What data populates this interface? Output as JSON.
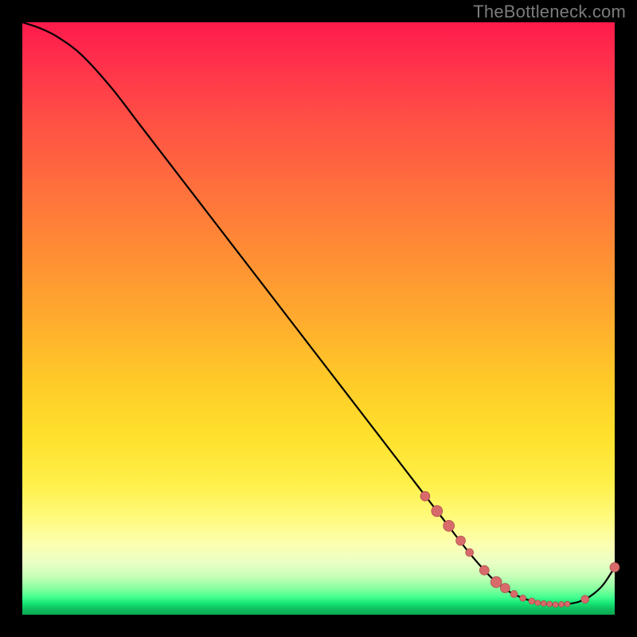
{
  "watermark": "TheBottleneck.com",
  "colors": {
    "background": "#000000",
    "curve": "#000000",
    "marker_fill": "#d86a6a",
    "marker_stroke": "#a04444"
  },
  "chart_data": {
    "type": "line",
    "title": "",
    "xlabel": "",
    "ylabel": "",
    "xlim": [
      0,
      100
    ],
    "ylim": [
      0,
      100
    ],
    "grid": false,
    "x": [
      0,
      3,
      6,
      10,
      15,
      20,
      25,
      30,
      35,
      40,
      45,
      50,
      55,
      60,
      65,
      70,
      75,
      78,
      80,
      82,
      84,
      86,
      88,
      90,
      92,
      94,
      96,
      98,
      100
    ],
    "y": [
      100,
      99,
      97.5,
      94.5,
      89,
      82.5,
      76,
      69.5,
      63,
      56.5,
      50,
      43.5,
      37,
      30.5,
      24,
      17.5,
      11,
      7.5,
      5.5,
      4,
      3,
      2.3,
      1.9,
      1.7,
      1.8,
      2.2,
      3.2,
      5,
      8
    ],
    "series": [
      {
        "name": "curve",
        "x": [
          0,
          3,
          6,
          10,
          15,
          20,
          25,
          30,
          35,
          40,
          45,
          50,
          55,
          60,
          65,
          70,
          75,
          78,
          80,
          82,
          84,
          86,
          88,
          90,
          92,
          94,
          96,
          98,
          100
        ],
        "y": [
          100,
          99,
          97.5,
          94.5,
          89,
          82.5,
          76,
          69.5,
          63,
          56.5,
          50,
          43.5,
          37,
          30.5,
          24,
          17.5,
          11,
          7.5,
          5.5,
          4,
          3,
          2.3,
          1.9,
          1.7,
          1.8,
          2.2,
          3.2,
          5,
          8
        ]
      }
    ],
    "markers": [
      {
        "x": 68,
        "y": 20,
        "r": 6
      },
      {
        "x": 70,
        "y": 17.5,
        "r": 7
      },
      {
        "x": 72,
        "y": 15,
        "r": 7
      },
      {
        "x": 74,
        "y": 12.5,
        "r": 6
      },
      {
        "x": 75.5,
        "y": 10.5,
        "r": 5
      },
      {
        "x": 78,
        "y": 7.5,
        "r": 6
      },
      {
        "x": 80,
        "y": 5.5,
        "r": 7
      },
      {
        "x": 81.5,
        "y": 4.5,
        "r": 6
      },
      {
        "x": 83,
        "y": 3.5,
        "r": 4.5
      },
      {
        "x": 84.5,
        "y": 2.8,
        "r": 4
      },
      {
        "x": 86,
        "y": 2.3,
        "r": 4
      },
      {
        "x": 87,
        "y": 2.0,
        "r": 3.5
      },
      {
        "x": 88,
        "y": 1.9,
        "r": 3.5
      },
      {
        "x": 89,
        "y": 1.8,
        "r": 3.5
      },
      {
        "x": 90,
        "y": 1.7,
        "r": 3.5
      },
      {
        "x": 91,
        "y": 1.75,
        "r": 3.5
      },
      {
        "x": 92,
        "y": 1.8,
        "r": 3.5
      },
      {
        "x": 95,
        "y": 2.6,
        "r": 5
      },
      {
        "x": 100,
        "y": 8,
        "r": 6
      }
    ]
  }
}
